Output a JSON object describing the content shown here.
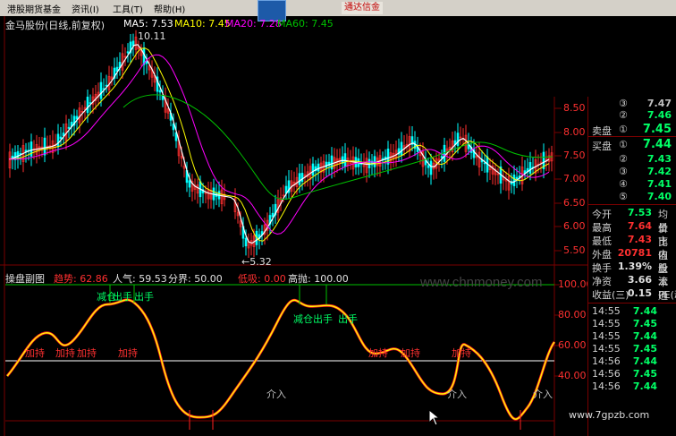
{
  "menu": {
    "items": [
      "港股期货基金",
      "资讯(I)",
      "工具(T)",
      "帮助(H)"
    ],
    "brand": "通达信金"
  },
  "main_chart": {
    "title": "金马股份(日线,前复权)",
    "ma5_label": "MA5: 7.53",
    "ma10_label": "MA10: 7.45",
    "ma20_label": "MA20: 7.28",
    "ma60_label": "MA60: 7.45",
    "high_marker": "10.11",
    "low_marker": "←5.32",
    "price_ticks": [
      "8.50",
      "8.00",
      "7.50",
      "7.00",
      "6.50",
      "6.00",
      "5.50"
    ],
    "colors": {
      "ma5": "#ffffff",
      "ma10": "#ffff00",
      "ma20": "#ff00ff",
      "ma60": "#00c000",
      "up": "#ff3030",
      "down": "#00ffff"
    }
  },
  "sub_chart": {
    "name": "操盘副图",
    "qushi": "趋势: 62.86",
    "renqi": "人气: 59.53",
    "fenjie": "分界: 50.00",
    "dixi": "低吸: 0.00",
    "gaopao": "高抛: 100.00",
    "ticks": [
      "100.00",
      "80.00",
      "60.00",
      "40.00"
    ],
    "signals": [
      "减仓",
      "出手",
      "出手",
      "减仓",
      "出手",
      "出手",
      "加持",
      "加持",
      "加持",
      "加持",
      "加持",
      "加持",
      "加持",
      "介入",
      "介入",
      "介入"
    ],
    "colors": {
      "trend": "#ffff00",
      "mood": "#ff2020",
      "line50": "#ffffff",
      "line100": "#00c000"
    }
  },
  "right_panel": {
    "ask_header": "卖盘",
    "ask_levels": [
      "③",
      "②",
      "①"
    ],
    "ask_prices": [
      "7.47",
      "7.46",
      "7.45"
    ],
    "bid_header": "买盘",
    "bid_levels": [
      "①",
      "②",
      "③",
      "④",
      "⑤"
    ],
    "bid_prices": [
      "7.44",
      "7.43",
      "7.42",
      "7.41",
      "7.40"
    ],
    "stats": [
      {
        "label": "今开",
        "value": "7.53",
        "tail": "均价"
      },
      {
        "label": "最高",
        "value": "7.64",
        "tail": "量比"
      },
      {
        "label": "最低",
        "value": "7.43",
        "tail": "市值"
      },
      {
        "label": "外盘",
        "value": "20781",
        "tail": "内盘"
      },
      {
        "label": "换手",
        "value": "1.39%",
        "tail": "股本"
      },
      {
        "label": "净资",
        "value": "3.66",
        "tail": "流通"
      },
      {
        "label": "收益(三)",
        "value": "0.15",
        "tail": "PE(动)"
      }
    ],
    "ticks_time": [
      "14:55",
      "14:55",
      "14:55",
      "14:55",
      "14:56",
      "14:56",
      "14:56"
    ],
    "ticks_price": [
      "7.44",
      "7.45",
      "7.44",
      "7.45",
      "7.44",
      "7.45",
      "7.44"
    ]
  },
  "watermark": "www.chnmoney.com",
  "watermark2": "www.7gpzb.com"
}
